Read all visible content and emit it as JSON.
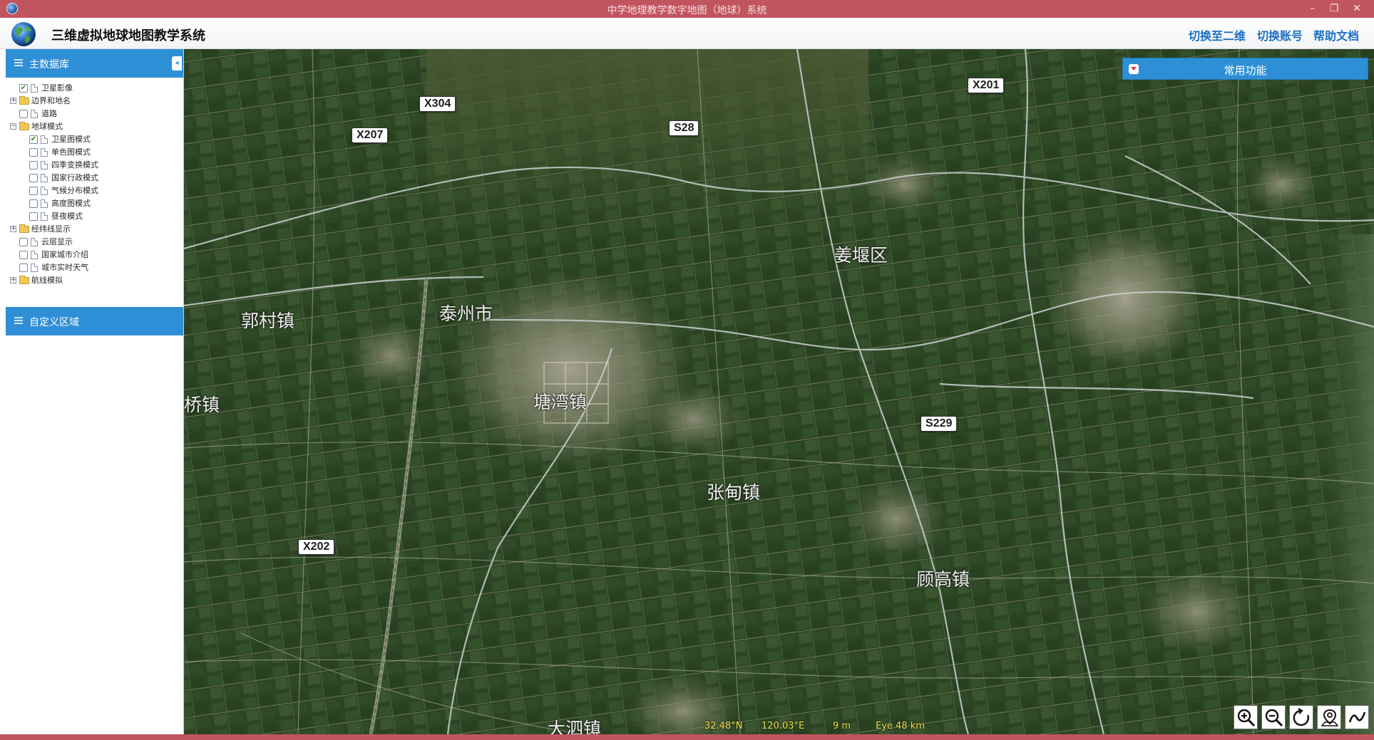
{
  "window": {
    "title": "中学地理教学数字地图（地球）系统",
    "accent_color": "#c1555f",
    "controls": [
      "minimize-icon",
      "restore-icon",
      "close-icon"
    ]
  },
  "header": {
    "app_title": "三维虚拟地球地图教学系统",
    "logo": "globe-icon",
    "links": {
      "switch_2d": "切换至二维",
      "switch_account": "切换账号",
      "help_docs": "帮助文档"
    },
    "link_color": "#1b6fc2"
  },
  "sidebar": {
    "header_color": "#2f8fd6",
    "main_db": {
      "title": "主数据库",
      "items": [
        {
          "label": "卫星影像",
          "level": 0,
          "checked": true,
          "expandable": false,
          "folder": false
        },
        {
          "label": "边界和地名",
          "level": 0,
          "checked": false,
          "expandable": true,
          "folder": true
        },
        {
          "label": "道路",
          "level": 0,
          "checked": false,
          "expandable": false,
          "folder": false
        },
        {
          "label": "地球模式",
          "level": 0,
          "checked": false,
          "expandable": true,
          "expanded": true,
          "folder": true
        },
        {
          "label": "卫星图模式",
          "level": 1,
          "checked": true,
          "expandable": false,
          "folder": false
        },
        {
          "label": "单色图模式",
          "level": 1,
          "checked": false,
          "expandable": false,
          "folder": false
        },
        {
          "label": "四季变换模式",
          "level": 1,
          "checked": false,
          "expandable": false,
          "folder": false
        },
        {
          "label": "国家行政模式",
          "level": 1,
          "checked": false,
          "expandable": false,
          "folder": false
        },
        {
          "label": "气候分布模式",
          "level": 1,
          "checked": false,
          "expandable": false,
          "folder": false
        },
        {
          "label": "高度图模式",
          "level": 1,
          "checked": false,
          "expandable": false,
          "folder": false
        },
        {
          "label": "昼夜模式",
          "level": 1,
          "checked": false,
          "expandable": false,
          "folder": false
        },
        {
          "label": "经纬线显示",
          "level": 0,
          "checked": false,
          "expandable": true,
          "folder": true
        },
        {
          "label": "云层显示",
          "level": 0,
          "checked": false,
          "expandable": false,
          "folder": false
        },
        {
          "label": "国家城市介绍",
          "level": 0,
          "checked": false,
          "expandable": false,
          "folder": false
        },
        {
          "label": "城市实时天气",
          "level": 0,
          "checked": false,
          "expandable": false,
          "folder": false
        },
        {
          "label": "航线模拟",
          "level": 0,
          "checked": false,
          "expandable": true,
          "folder": true
        }
      ]
    },
    "custom_region": {
      "title": "自定义区域"
    }
  },
  "map": {
    "common_functions": "常用功能",
    "road_shields": [
      {
        "id": "x304",
        "label": "X304"
      },
      {
        "id": "x207",
        "label": "X207"
      },
      {
        "id": "s28",
        "label": "S28"
      },
      {
        "id": "x201",
        "label": "X201"
      },
      {
        "id": "s229",
        "label": "S229"
      },
      {
        "id": "x202",
        "label": "X202"
      }
    ],
    "places": [
      {
        "id": "jiangyan",
        "label": "姜堰区"
      },
      {
        "id": "taizhou",
        "label": "泰州市"
      },
      {
        "id": "guocun",
        "label": "郭村镇"
      },
      {
        "id": "qiao",
        "label": "桥镇"
      },
      {
        "id": "tangwan",
        "label": "塘湾镇"
      },
      {
        "id": "zhangdian",
        "label": "张甸镇"
      },
      {
        "id": "gugao",
        "label": "顾高镇"
      },
      {
        "id": "dalun",
        "label": "大泗镇"
      }
    ],
    "status": {
      "lat": "32.48°N",
      "lon": "120.03°E",
      "elevation": "9 m",
      "eye": "Eye  48 km"
    },
    "tools": [
      "zoom-in-icon",
      "zoom-out-icon",
      "rotate-icon",
      "pin-icon",
      "measure-icon"
    ]
  }
}
